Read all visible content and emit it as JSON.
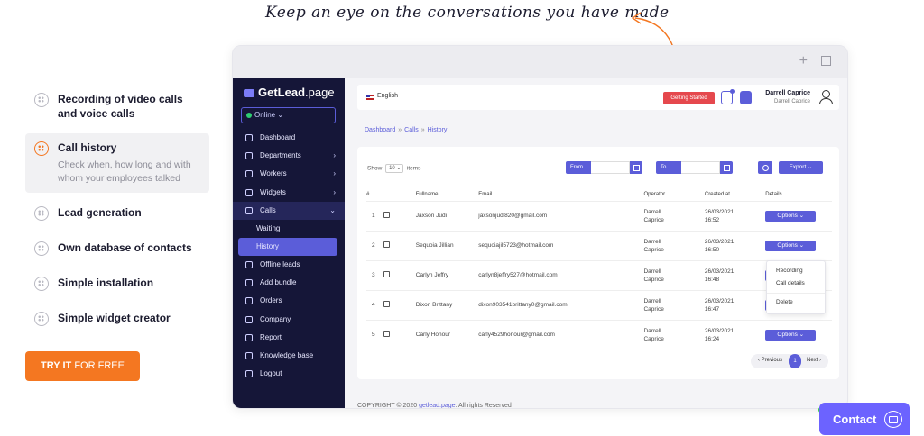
{
  "tagline": "Keep an eye on the conversations you have made",
  "features": [
    {
      "title": "Recording of video calls and voice calls",
      "desc": ""
    },
    {
      "title": "Call history",
      "desc": "Check when, how long and with whom your employees talked"
    },
    {
      "title": "Lead generation",
      "desc": ""
    },
    {
      "title": "Own database of contacts",
      "desc": ""
    },
    {
      "title": "Simple installation",
      "desc": ""
    },
    {
      "title": "Simple widget creator",
      "desc": ""
    }
  ],
  "cta": {
    "bold": "TRY IT",
    "rest": " FOR FREE"
  },
  "app": {
    "brand_main": "GetLead",
    "brand_suffix": ".page",
    "status": "Online",
    "nav": [
      {
        "label": "Dashboard",
        "icon": "home-icon"
      },
      {
        "label": "Departments",
        "icon": "building-icon",
        "chevron": "›"
      },
      {
        "label": "Workers",
        "icon": "users-icon",
        "chevron": "›"
      },
      {
        "label": "Widgets",
        "icon": "widget-icon",
        "chevron": "›"
      },
      {
        "label": "Calls",
        "icon": "phone-icon",
        "chevron": "⌄"
      }
    ],
    "subnav": [
      "Waiting",
      "History"
    ],
    "nav2": [
      {
        "label": "Offline leads",
        "icon": "offline-icon"
      },
      {
        "label": "Add bundle",
        "icon": "user-plus-icon"
      },
      {
        "label": "Orders",
        "icon": "orders-icon"
      },
      {
        "label": "Company",
        "icon": "command-icon"
      },
      {
        "label": "Report",
        "icon": "chat-icon"
      },
      {
        "label": "Knowledge base",
        "icon": "help-icon"
      },
      {
        "label": "Logout",
        "icon": "logout-icon"
      }
    ],
    "language": "English",
    "getting_started": "Getting Started",
    "user_name": "Darrell Caprice",
    "user_sub": "Darrell Caprice",
    "breadcrumb": [
      "Dashboard",
      "Calls",
      "History"
    ],
    "show_label": "Show",
    "show_value": "10",
    "items_label": "items",
    "from_label": "From",
    "to_label": "To",
    "export_label": "Export ⌄",
    "columns": [
      "#",
      "",
      "Fullname",
      "Email",
      "Operator",
      "Created at",
      "Details"
    ],
    "rows": [
      {
        "n": "1",
        "name": "Jaxson Judi",
        "email": "jaxsonjudi820@gmail.com",
        "op1": "Darrell",
        "op2": "Caprice",
        "d1": "26/03/2021",
        "d2": "16:52"
      },
      {
        "n": "2",
        "name": "Sequoia Jillian",
        "email": "sequoiajil5723@hotmail.com",
        "op1": "Darrell",
        "op2": "Caprice",
        "d1": "26/03/2021",
        "d2": "16:50"
      },
      {
        "n": "3",
        "name": "Carlyn Jeffry",
        "email": "carlyn8jeffry527@hotmail.com",
        "op1": "Darrell",
        "op2": "Caprice",
        "d1": "26/03/2021",
        "d2": "16:48"
      },
      {
        "n": "4",
        "name": "Dixon Brittany",
        "email": "dixon903541brittany0@gmail.com",
        "op1": "Darrell",
        "op2": "Caprice",
        "d1": "26/03/2021",
        "d2": "16:47"
      },
      {
        "n": "5",
        "name": "Carly Honour",
        "email": "carly4529honour@gmail.com",
        "op1": "Darrell",
        "op2": "Caprice",
        "d1": "26/03/2021",
        "d2": "16:24"
      }
    ],
    "options_label": "Options ⌄",
    "menu": [
      "Recording",
      "Call details",
      "Delete"
    ],
    "pager": {
      "prev": "‹ Previous",
      "current": "1",
      "next": "Next ›"
    },
    "copyright_pre": "COPYRIGHT © 2020 ",
    "copyright_link": "getlead.page",
    "copyright_post": ". All rights Reserved"
  },
  "contact_label": "Contact",
  "colors": {
    "accent": "#5b5dd9",
    "orange": "#f47721",
    "sidebar": "#151638"
  }
}
